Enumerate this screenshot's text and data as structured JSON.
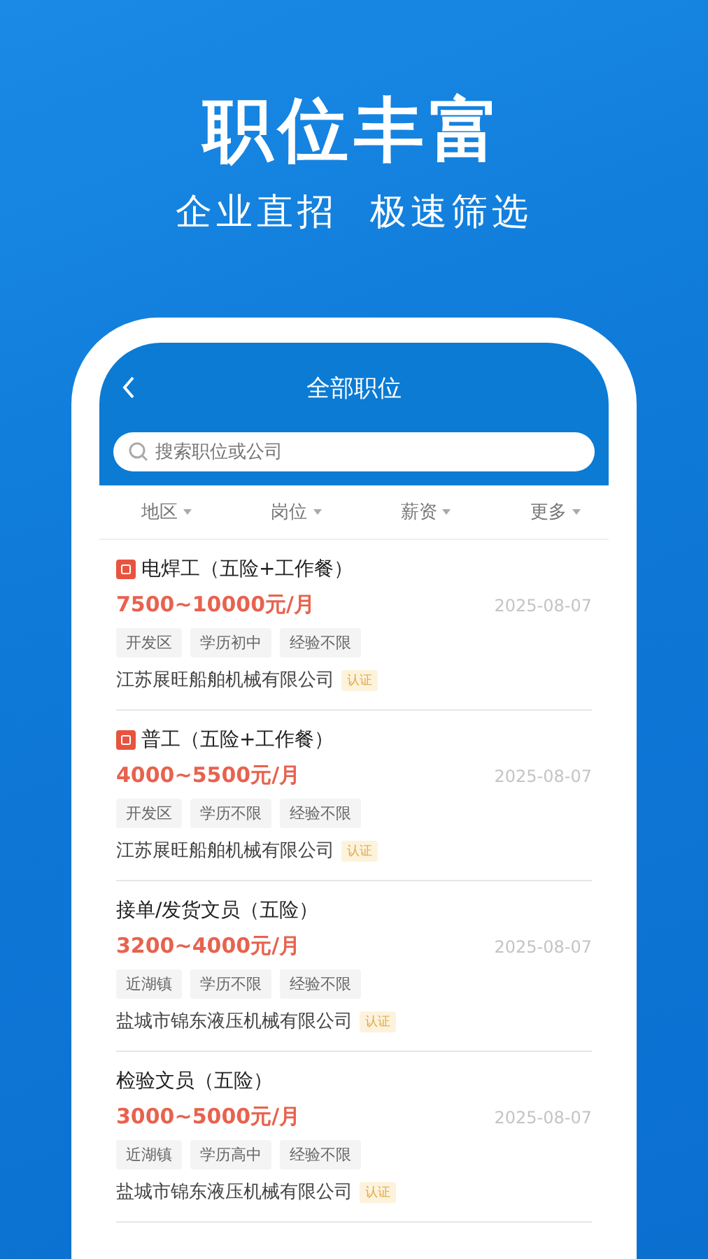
{
  "headline": "职位丰富",
  "subtitle": "企业直招  极速筛选",
  "screen": {
    "title": "全部职位",
    "search": {
      "placeholder": "搜索职位或公司"
    },
    "filters": [
      "地区",
      "岗位",
      "薪资",
      "更多"
    ],
    "jobs": [
      {
        "title": "电焊工（五险+工作餐）",
        "urgent": true,
        "salary": "7500~10000元/月",
        "date": "2025-08-07",
        "tags": [
          "开发区",
          "学历初中",
          "经验不限"
        ],
        "company": "江苏展旺船舶机械有限公司",
        "badge": "认证"
      },
      {
        "title": "普工（五险+工作餐）",
        "urgent": true,
        "salary": "4000~5500元/月",
        "date": "2025-08-07",
        "tags": [
          "开发区",
          "学历不限",
          "经验不限"
        ],
        "company": "江苏展旺船舶机械有限公司",
        "badge": "认证"
      },
      {
        "title": "接单/发货文员（五险）",
        "urgent": false,
        "salary": "3200~4000元/月",
        "date": "2025-08-07",
        "tags": [
          "近湖镇",
          "学历不限",
          "经验不限"
        ],
        "company": "盐城市锦东液压机械有限公司",
        "badge": "认证"
      },
      {
        "title": "检验文员（五险）",
        "urgent": false,
        "salary": "3000~5000元/月",
        "date": "2025-08-07",
        "tags": [
          "近湖镇",
          "学历高中",
          "经验不限"
        ],
        "company": "盐城市锦东液压机械有限公司",
        "badge": "认证"
      }
    ]
  }
}
